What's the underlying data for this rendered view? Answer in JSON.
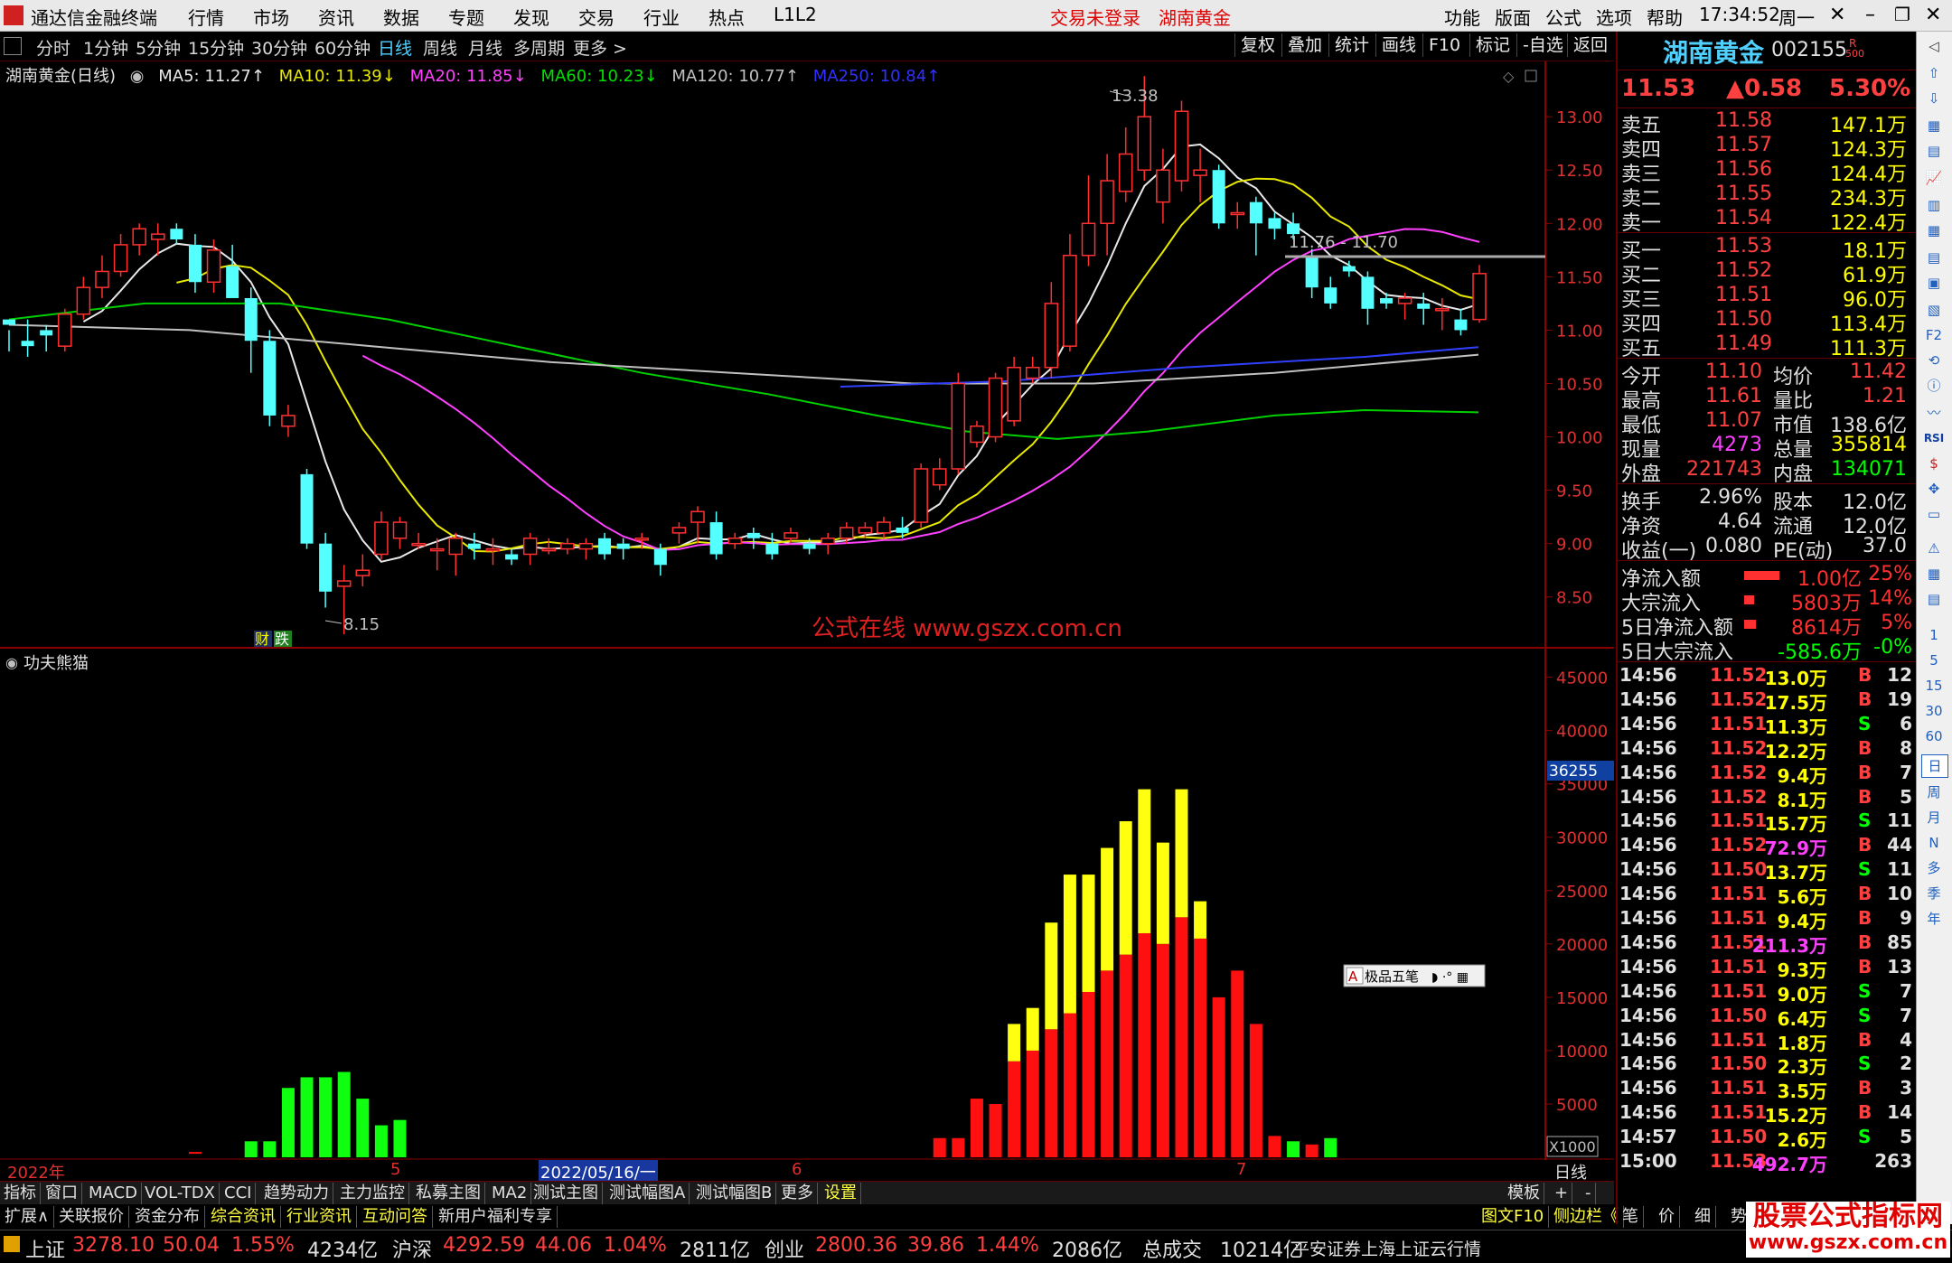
{
  "app": {
    "title": "通达信金融终端",
    "menus": [
      "行情",
      "市场",
      "资讯",
      "数据",
      "专题",
      "发现",
      "交易",
      "行业",
      "热点",
      "L1L2"
    ],
    "trade_status": "交易未登录",
    "stock_title": "湖南黄金",
    "right_menus": [
      "功能",
      "版面",
      "公式",
      "选项",
      "帮助"
    ],
    "clock": "17:34:52",
    "weekday": "周一"
  },
  "periods": [
    "分时",
    "1分钟",
    "5分钟",
    "15分钟",
    "30分钟",
    "60分钟",
    "日线",
    "周线",
    "月线",
    "多周期",
    "更多 >"
  ],
  "active_period": "日线",
  "toolbar_right": [
    "复权",
    "叠加",
    "统计",
    "画线",
    "F10",
    "标记",
    "-自选",
    "返回"
  ],
  "legend": {
    "name": "湖南黄金(日线)",
    "items": [
      {
        "text": "MA5: 11.27↑",
        "color": "#e8e8e8"
      },
      {
        "text": "MA10: 11.39↓",
        "color": "#e8e800"
      },
      {
        "text": "MA20: 11.85↓",
        "color": "#ff40ff"
      },
      {
        "text": "MA60: 10.23↓",
        "color": "#00e000"
      },
      {
        "text": "MA120: 10.77↑",
        "color": "#c0c0c0"
      },
      {
        "text": "MA250: 10.84↑",
        "color": "#3030ff"
      }
    ]
  },
  "price_axis": [
    "13.00",
    "12.50",
    "12.00",
    "11.50",
    "11.00",
    "10.50",
    "10.00",
    "9.50",
    "9.00",
    "8.50"
  ],
  "annotations": {
    "high": "13.38",
    "low": "8.15",
    "range": "11.76 - 11.70",
    "badge1": "财",
    "badge2": "跌"
  },
  "watermark": "公式在线  www.gszx.com.cn",
  "indicator": {
    "name": "功夫熊猫",
    "axis": [
      "45000",
      "40000",
      "35000",
      "30000",
      "25000",
      "20000",
      "15000",
      "10000",
      "5000"
    ],
    "current": "36255",
    "multiplier": "X1000",
    "ime": "极品五笔"
  },
  "date_axis": [
    "2022年",
    "5",
    "2022/05/16/一",
    "6",
    "7",
    "日线"
  ],
  "chart_data": {
    "type": "candlestick",
    "ohlc": [
      [
        11.1,
        11.0,
        10.8,
        11.05
      ],
      [
        10.9,
        11.1,
        10.75,
        10.85
      ],
      [
        11.0,
        11.05,
        10.8,
        10.95
      ],
      [
        10.85,
        11.2,
        10.8,
        11.15
      ],
      [
        11.15,
        11.5,
        11.1,
        11.4
      ],
      [
        11.4,
        11.7,
        11.3,
        11.55
      ],
      [
        11.55,
        11.9,
        11.5,
        11.8
      ],
      [
        11.8,
        12.0,
        11.7,
        11.95
      ],
      [
        11.85,
        12.0,
        11.7,
        11.9
      ],
      [
        11.95,
        12.0,
        11.8,
        11.85
      ],
      [
        11.8,
        11.9,
        11.35,
        11.45
      ],
      [
        11.45,
        11.85,
        11.35,
        11.75
      ],
      [
        11.6,
        11.8,
        11.3,
        11.3
      ],
      [
        11.3,
        11.4,
        10.6,
        10.9
      ],
      [
        10.9,
        11.0,
        10.1,
        10.2
      ],
      [
        10.1,
        10.3,
        10.0,
        10.2
      ],
      [
        9.65,
        9.7,
        8.95,
        9.0
      ],
      [
        9.0,
        9.1,
        8.4,
        8.55
      ],
      [
        8.6,
        8.8,
        8.15,
        8.65
      ],
      [
        8.7,
        8.9,
        8.6,
        8.75
      ],
      [
        8.9,
        9.3,
        8.85,
        9.2
      ],
      [
        9.05,
        9.25,
        8.95,
        9.2
      ],
      [
        9.0,
        9.1,
        8.95,
        9.0
      ],
      [
        8.95,
        9.05,
        8.75,
        8.95
      ],
      [
        8.9,
        9.1,
        8.7,
        9.05
      ],
      [
        9.0,
        9.1,
        8.85,
        8.95
      ],
      [
        8.95,
        9.05,
        8.8,
        8.95
      ],
      [
        8.9,
        8.95,
        8.8,
        8.85
      ],
      [
        8.9,
        9.1,
        8.8,
        9.05
      ],
      [
        8.95,
        9.05,
        8.9,
        8.95
      ],
      [
        8.95,
        9.05,
        8.9,
        9.0
      ],
      [
        8.95,
        9.05,
        8.85,
        9.0
      ],
      [
        9.05,
        9.1,
        8.85,
        8.9
      ],
      [
        9.0,
        9.05,
        8.85,
        8.95
      ],
      [
        9.05,
        9.1,
        8.95,
        9.05
      ],
      [
        8.95,
        9.0,
        8.7,
        8.8
      ],
      [
        9.1,
        9.2,
        9.0,
        9.15
      ],
      [
        9.2,
        9.35,
        9.0,
        9.3
      ],
      [
        9.2,
        9.3,
        8.85,
        8.9
      ],
      [
        9.0,
        9.1,
        8.95,
        9.05
      ],
      [
        9.1,
        9.15,
        8.95,
        9.05
      ],
      [
        9.0,
        9.1,
        8.85,
        8.9
      ],
      [
        9.05,
        9.15,
        9.0,
        9.1
      ],
      [
        9.0,
        9.05,
        8.9,
        8.95
      ],
      [
        9.0,
        9.1,
        8.9,
        9.05
      ],
      [
        9.05,
        9.2,
        9.0,
        9.15
      ],
      [
        9.1,
        9.2,
        9.05,
        9.15
      ],
      [
        9.1,
        9.25,
        9.05,
        9.2
      ],
      [
        9.15,
        9.25,
        9.05,
        9.1
      ],
      [
        9.2,
        9.75,
        9.15,
        9.7
      ],
      [
        9.55,
        9.8,
        9.5,
        9.7
      ],
      [
        9.7,
        10.6,
        9.65,
        10.5
      ],
      [
        9.95,
        10.15,
        9.9,
        10.1
      ],
      [
        10.0,
        10.6,
        9.95,
        10.55
      ],
      [
        10.15,
        10.75,
        10.1,
        10.65
      ],
      [
        10.55,
        10.75,
        10.5,
        10.65
      ],
      [
        10.65,
        11.45,
        10.55,
        11.25
      ],
      [
        10.85,
        11.9,
        10.8,
        11.7
      ],
      [
        11.7,
        12.45,
        11.6,
        12.0
      ],
      [
        12.0,
        12.65,
        11.7,
        12.4
      ],
      [
        12.3,
        12.9,
        12.2,
        12.65
      ],
      [
        12.5,
        13.38,
        12.4,
        13.0
      ],
      [
        12.2,
        12.7,
        12.0,
        12.5
      ],
      [
        12.4,
        13.15,
        12.3,
        13.05
      ],
      [
        12.45,
        12.7,
        12.2,
        12.5
      ],
      [
        12.5,
        12.55,
        11.95,
        12.0
      ],
      [
        12.1,
        12.2,
        11.95,
        12.1
      ],
      [
        12.2,
        12.25,
        11.7,
        12.0
      ],
      [
        12.05,
        12.1,
        11.85,
        11.95
      ],
      [
        12.0,
        12.1,
        11.85,
        11.9
      ],
      [
        11.7,
        11.76,
        11.3,
        11.4
      ],
      [
        11.4,
        11.5,
        11.2,
        11.25
      ],
      [
        11.6,
        11.65,
        11.5,
        11.55
      ],
      [
        11.5,
        11.55,
        11.05,
        11.2
      ],
      [
        11.3,
        11.35,
        11.2,
        11.25
      ],
      [
        11.25,
        11.35,
        11.1,
        11.3
      ],
      [
        11.25,
        11.35,
        11.05,
        11.2
      ],
      [
        11.2,
        11.3,
        11.0,
        11.2
      ],
      [
        11.1,
        11.2,
        10.95,
        11.0
      ],
      [
        11.1,
        11.61,
        11.07,
        11.53
      ]
    ],
    "ma_values": {
      "MA5": 11.27,
      "MA10": 11.39,
      "MA20": 11.85,
      "MA60": 10.23,
      "MA120": 10.77,
      "MA250": 10.84
    },
    "ylim": [
      8.1,
      13.45
    ],
    "indicator_bars": {
      "ylim": [
        0,
        47000
      ],
      "values": [
        {
          "i": 10,
          "v": 500,
          "c": "red"
        },
        {
          "i": 13,
          "v": 1500,
          "c": "green"
        },
        {
          "i": 14,
          "v": 1500,
          "c": "green"
        },
        {
          "i": 15,
          "v": 6500,
          "c": "green"
        },
        {
          "i": 16,
          "v": 7500,
          "c": "green"
        },
        {
          "i": 17,
          "v": 7500,
          "c": "green"
        },
        {
          "i": 18,
          "v": 8000,
          "c": "green"
        },
        {
          "i": 19,
          "v": 5500,
          "c": "green"
        },
        {
          "i": 20,
          "v": 3000,
          "c": "green"
        },
        {
          "i": 21,
          "v": 3500,
          "c": "green"
        },
        {
          "i": 50,
          "v": 1800,
          "c": "red"
        },
        {
          "i": 51,
          "v": 1800,
          "c": "red"
        },
        {
          "i": 52,
          "v": 5500,
          "c": "red"
        },
        {
          "i": 53,
          "v": 5000,
          "c": "red"
        },
        {
          "i": 54,
          "v": 9000,
          "c": "red",
          "y": 3500
        },
        {
          "i": 55,
          "v": 10000,
          "c": "red",
          "y": 4000
        },
        {
          "i": 56,
          "v": 12000,
          "c": "red",
          "y": 10000
        },
        {
          "i": 57,
          "v": 13500,
          "c": "red",
          "y": 13000
        },
        {
          "i": 58,
          "v": 15500,
          "c": "red",
          "y": 11000
        },
        {
          "i": 59,
          "v": 17500,
          "c": "red",
          "y": 11500
        },
        {
          "i": 60,
          "v": 19000,
          "c": "red",
          "y": 12500
        },
        {
          "i": 61,
          "v": 21000,
          "c": "red",
          "y": 13500
        },
        {
          "i": 62,
          "v": 20000,
          "c": "red",
          "y": 9500
        },
        {
          "i": 63,
          "v": 22500,
          "c": "red",
          "y": 12000
        },
        {
          "i": 64,
          "v": 20500,
          "c": "red",
          "y": 3500
        },
        {
          "i": 65,
          "v": 15000,
          "c": "red"
        },
        {
          "i": 66,
          "v": 17500,
          "c": "red"
        },
        {
          "i": 67,
          "v": 12500,
          "c": "red"
        },
        {
          "i": 68,
          "v": 2000,
          "c": "red"
        },
        {
          "i": 69,
          "v": 1500,
          "c": "green"
        },
        {
          "i": 70,
          "v": 1200,
          "c": "red"
        },
        {
          "i": 71,
          "v": 1800,
          "c": "green"
        }
      ]
    }
  },
  "quote": {
    "name": "湖南黄金",
    "code": "002155",
    "price": "11.53",
    "change": "▲0.58",
    "pct": "5.30%",
    "sells": [
      {
        "label": "卖五",
        "price": "11.58",
        "vol": "147.1万"
      },
      {
        "label": "卖四",
        "price": "11.57",
        "vol": "124.3万"
      },
      {
        "label": "卖三",
        "price": "11.56",
        "vol": "124.4万"
      },
      {
        "label": "卖二",
        "price": "11.55",
        "vol": "234.3万"
      },
      {
        "label": "卖一",
        "price": "11.54",
        "vol": "122.4万"
      }
    ],
    "buys": [
      {
        "label": "买一",
        "price": "11.53",
        "vol": "18.1万"
      },
      {
        "label": "买二",
        "price": "11.52",
        "vol": "61.9万"
      },
      {
        "label": "买三",
        "price": "11.51",
        "vol": "96.0万"
      },
      {
        "label": "买四",
        "price": "11.50",
        "vol": "113.4万"
      },
      {
        "label": "买五",
        "price": "11.49",
        "vol": "111.3万"
      }
    ],
    "stats": [
      {
        "l1": "今开",
        "v1": "11.10",
        "c1": "#ff4040",
        "l2": "均价",
        "v2": "11.42",
        "c2": "#ff4040"
      },
      {
        "l1": "最高",
        "v1": "11.61",
        "c1": "#ff4040",
        "l2": "量比",
        "v2": "1.21",
        "c2": "#ff4040"
      },
      {
        "l1": "最低",
        "v1": "11.07",
        "c1": "#ff4040",
        "l2": "市值",
        "v2": "138.6亿",
        "c2": "#e0e0e0"
      },
      {
        "l1": "现量",
        "v1": "4273",
        "c1": "#ff40ff",
        "l2": "总量",
        "v2": "355814",
        "c2": "#ffff00"
      },
      {
        "l1": "外盘",
        "v1": "221743",
        "c1": "#ff4040",
        "l2": "内盘",
        "v2": "134071",
        "c2": "#00ff00"
      }
    ],
    "stats2": [
      {
        "l1": "换手",
        "v1": "2.96%",
        "l2": "股本",
        "v2": "12.0亿"
      },
      {
        "l1": "净资",
        "v1": "4.64",
        "l2": "流通",
        "v2": "12.0亿"
      },
      {
        "l1": "收益(一)",
        "v1": "0.080",
        "l2": "PE(动)",
        "v2": "37.0"
      }
    ],
    "flows": [
      {
        "label": "净流入额",
        "val": "1.00亿",
        "pct": "25%",
        "bar": 70,
        "color": "#ff3030"
      },
      {
        "label": "大宗流入",
        "val": "5803万",
        "pct": "14%",
        "bar": 20,
        "color": "#ff3030"
      },
      {
        "label": "5日净流入额",
        "val": "8614万",
        "pct": "5%",
        "bar": 24,
        "color": "#ff3030"
      },
      {
        "label": "5日大宗流入",
        "val": "-585.6万",
        "pct": "-0%",
        "bar": 0,
        "color": "#00ff00"
      }
    ],
    "ticks": [
      {
        "t": "14:56",
        "p": "11.52",
        "v": "13.0万",
        "bs": "B",
        "n": "12",
        "vc": "#ffff00"
      },
      {
        "t": "14:56",
        "p": "11.52",
        "v": "17.5万",
        "bs": "B",
        "n": "19",
        "vc": "#ffff00"
      },
      {
        "t": "14:56",
        "p": "11.51",
        "v": "11.3万",
        "bs": "S",
        "n": "6",
        "vc": "#ffff00"
      },
      {
        "t": "14:56",
        "p": "11.52",
        "v": "12.2万",
        "bs": "B",
        "n": "8",
        "vc": "#ffff00"
      },
      {
        "t": "14:56",
        "p": "11.52",
        "v": "9.4万",
        "bs": "B",
        "n": "7",
        "vc": "#ffff00"
      },
      {
        "t": "14:56",
        "p": "11.52",
        "v": "8.1万",
        "bs": "B",
        "n": "5",
        "vc": "#ffff00"
      },
      {
        "t": "14:56",
        "p": "11.51",
        "v": "15.7万",
        "bs": "S",
        "n": "11",
        "vc": "#ffff00"
      },
      {
        "t": "14:56",
        "p": "11.52",
        "v": "72.9万",
        "bs": "B",
        "n": "44",
        "vc": "#ff40ff"
      },
      {
        "t": "14:56",
        "p": "11.50",
        "v": "13.7万",
        "bs": "S",
        "n": "11",
        "vc": "#ffff00"
      },
      {
        "t": "14:56",
        "p": "11.51",
        "v": "5.6万",
        "bs": "B",
        "n": "10",
        "vc": "#ffff00"
      },
      {
        "t": "14:56",
        "p": "11.51",
        "v": "9.4万",
        "bs": "B",
        "n": "9",
        "vc": "#ffff00"
      },
      {
        "t": "14:56",
        "p": "11.51",
        "v": "211.3万",
        "bs": "B",
        "n": "85",
        "vc": "#ff40ff"
      },
      {
        "t": "14:56",
        "p": "11.51",
        "v": "9.3万",
        "bs": "B",
        "n": "13",
        "vc": "#ffff00"
      },
      {
        "t": "14:56",
        "p": "11.51",
        "v": "9.0万",
        "bs": "S",
        "n": "7",
        "vc": "#ffff00"
      },
      {
        "t": "14:56",
        "p": "11.50",
        "v": "6.4万",
        "bs": "S",
        "n": "7",
        "vc": "#ffff00"
      },
      {
        "t": "14:56",
        "p": "11.51",
        "v": "1.8万",
        "bs": "B",
        "n": "4",
        "vc": "#ffff00"
      },
      {
        "t": "14:56",
        "p": "11.50",
        "v": "2.3万",
        "bs": "S",
        "n": "2",
        "vc": "#ffff00"
      },
      {
        "t": "14:56",
        "p": "11.51",
        "v": "3.5万",
        "bs": "B",
        "n": "3",
        "vc": "#ffff00"
      },
      {
        "t": "14:56",
        "p": "11.51",
        "v": "15.2万",
        "bs": "B",
        "n": "14",
        "vc": "#ffff00"
      },
      {
        "t": "14:57",
        "p": "11.50",
        "v": "2.6万",
        "bs": "S",
        "n": "5",
        "vc": "#ffff00"
      },
      {
        "t": "15:00",
        "p": "11.53",
        "v": "492.7万",
        "bs": "",
        "n": "263",
        "vc": "#ff40ff"
      }
    ]
  },
  "bottom_tabs": [
    "指标",
    "窗口",
    "MACD",
    "VOL-TDX",
    "CCI",
    "趋势动力",
    "主力监控",
    "私募主图",
    "MA2",
    "测试主图",
    "测试幅图A",
    "测试幅图B",
    "更多",
    "设置"
  ],
  "bottom_right": [
    "模板",
    "+",
    "-"
  ],
  "ext_tabs": [
    "扩展∧",
    "关联报价",
    "资金分布",
    "综合资讯",
    "行业资讯",
    "互动问答",
    "新用户福利专享"
  ],
  "ext_right": [
    "图文F10",
    "侧边栏《",
    "笔",
    "价",
    "细",
    "势"
  ],
  "status": {
    "sh_label": "上证",
    "sh_val": "3278.10",
    "sh_chg": "50.04",
    "sh_pct": "1.55%",
    "sh_amt": "4234亿",
    "hs_label": "沪深",
    "hs_val": "4292.59",
    "hs_chg": "44.06",
    "hs_pct": "1.04%",
    "hs_amt": "2811亿",
    "cy_label": "创业",
    "cy_val": "2800.36",
    "cy_chg": "39.86",
    "cy_pct": "1.44%",
    "cy_amt": "2086亿",
    "total_label": "总成交",
    "total_val": "10214亿",
    "source": "平安证券上海上证云行情"
  },
  "logo": {
    "line1": "股票公式指标网",
    "line2": "www.gszx.com.cn"
  },
  "side_icons": [
    "多",
    "周",
    "月",
    "N",
    "多",
    "季",
    "年"
  ]
}
